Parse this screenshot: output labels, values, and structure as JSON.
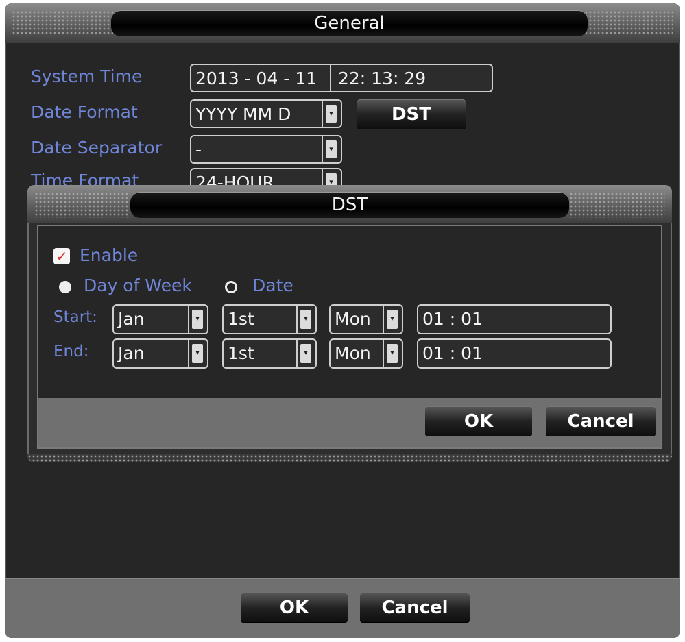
{
  "general": {
    "title": "General",
    "fields": {
      "system_time": {
        "label": "System Time",
        "date": "2013 - 04 - 11",
        "time": "22: 13: 29"
      },
      "date_format": {
        "label": "Date Format",
        "value": "YYYY MM D"
      },
      "date_separator": {
        "label": "Date Separator",
        "value": "-"
      },
      "time_format": {
        "label": "Time Format",
        "value": "24-HOUR"
      }
    },
    "dst_button": "DST",
    "ok": "OK",
    "cancel": "Cancel"
  },
  "dst": {
    "title": "DST",
    "enable": {
      "label": "Enable",
      "checked": true,
      "check_glyph": "✓"
    },
    "mode_options": [
      {
        "label": "Day of Week",
        "selected": true
      },
      {
        "label": "Date",
        "selected": false
      }
    ],
    "start": {
      "label": "Start:",
      "month": "Jan",
      "week": "1st",
      "day": "Mon",
      "time": "01  :  01"
    },
    "end": {
      "label": "End:",
      "month": "Jan",
      "week": "1st",
      "day": "Mon",
      "time": "01  :  01"
    },
    "ok": "OK",
    "cancel": "Cancel"
  },
  "icons": {
    "dropdown_arrow": "▾"
  },
  "colors": {
    "label_blue": "#6f86d8",
    "panel_dark": "#262626",
    "footer_gray": "#707070"
  }
}
